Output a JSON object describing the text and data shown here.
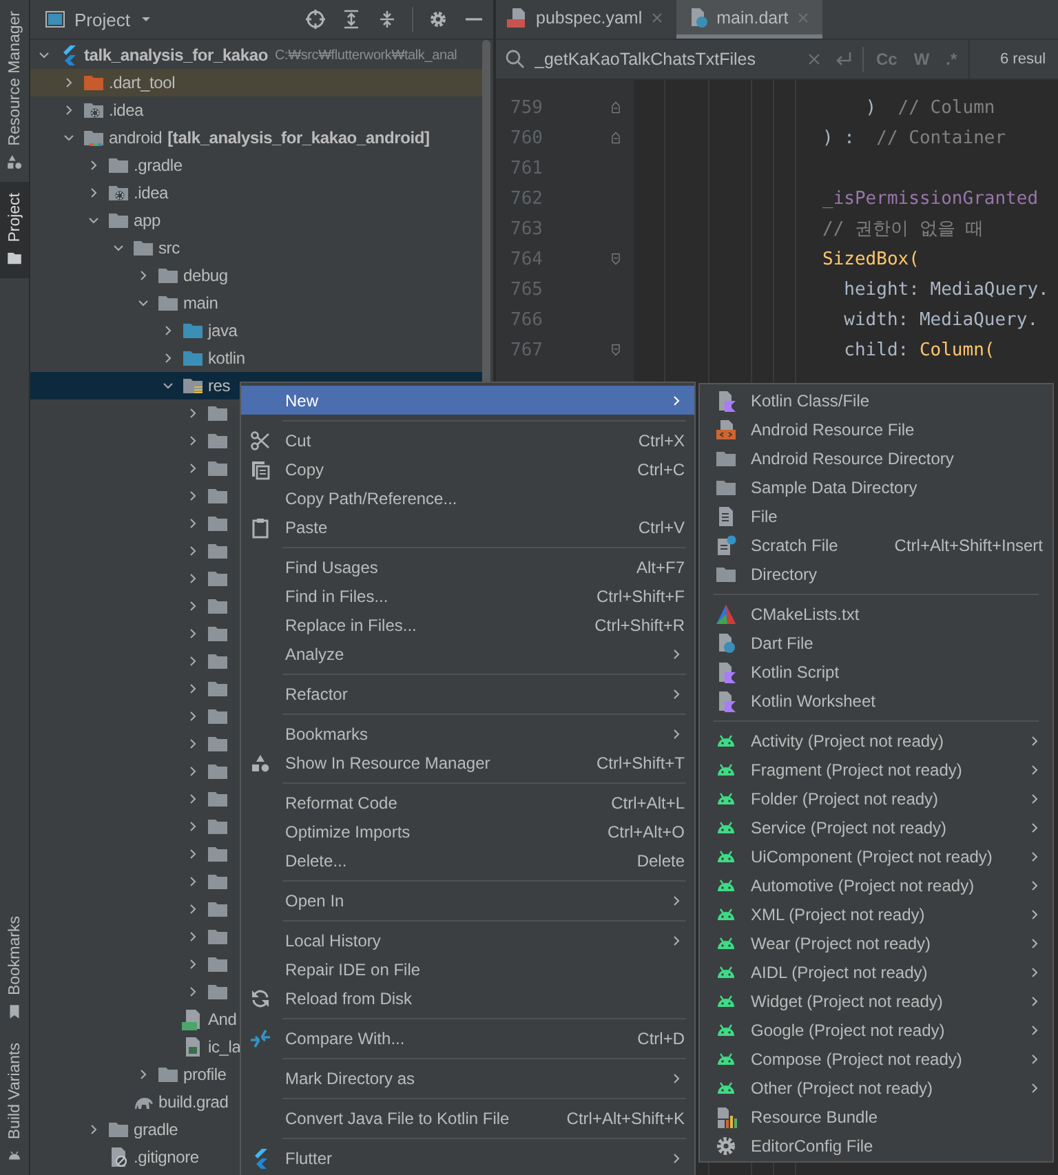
{
  "tool_strip": {
    "top": [
      {
        "label": "Resource Manager",
        "selected": false
      },
      {
        "label": "Project",
        "selected": true
      }
    ],
    "bottom": [
      {
        "label": "Bookmarks",
        "selected": false
      },
      {
        "label": "Build Variants",
        "selected": false
      }
    ]
  },
  "project_panel": {
    "view": "Project",
    "tree": [
      {
        "label": "talk_analysis_for_kakao",
        "path": "C:₩src₩flutterwork₩talk_anal",
        "kind": "project",
        "expanded": true,
        "selected": false,
        "children": [
          {
            "label": ".dart_tool",
            "kind": "excluded",
            "expanded": false,
            "selected": false
          },
          {
            "label": ".idea",
            "kind": "config",
            "expanded": false,
            "selected": false
          },
          {
            "label": "android",
            "module": "[talk_analysis_for_kakao_android]",
            "kind": "module",
            "expanded": true,
            "selected": false,
            "children": [
              {
                "label": ".gradle",
                "kind": "folder",
                "expanded": false,
                "selected": false
              },
              {
                "label": ".idea",
                "kind": "config",
                "expanded": false,
                "selected": false
              },
              {
                "label": "app",
                "kind": "folder",
                "expanded": true,
                "selected": false,
                "children": [
                  {
                    "label": "src",
                    "kind": "folder",
                    "expanded": true,
                    "selected": false,
                    "children": [
                      {
                        "label": "debug",
                        "kind": "folder",
                        "expanded": false,
                        "selected": false
                      },
                      {
                        "label": "main",
                        "kind": "folder",
                        "expanded": true,
                        "selected": false,
                        "children": [
                          {
                            "label": "java",
                            "kind": "source",
                            "expanded": false,
                            "selected": false
                          },
                          {
                            "label": "kotlin",
                            "kind": "source",
                            "expanded": false,
                            "selected": false
                          },
                          {
                            "label": "res",
                            "kind": "resources",
                            "expanded": true,
                            "selected": true,
                            "children": [
                              {
                                "kind": "folder",
                                "expanded": false,
                                "selected": false
                              },
                              {
                                "kind": "folder",
                                "expanded": false,
                                "selected": false
                              },
                              {
                                "kind": "folder",
                                "expanded": false,
                                "selected": false
                              },
                              {
                                "kind": "folder",
                                "expanded": false,
                                "selected": false
                              },
                              {
                                "kind": "folder",
                                "expanded": false,
                                "selected": false
                              },
                              {
                                "kind": "folder",
                                "expanded": false,
                                "selected": false
                              },
                              {
                                "kind": "folder",
                                "expanded": false,
                                "selected": false
                              },
                              {
                                "kind": "folder",
                                "expanded": false,
                                "selected": false
                              },
                              {
                                "kind": "folder",
                                "expanded": false,
                                "selected": false
                              },
                              {
                                "kind": "folder",
                                "expanded": false,
                                "selected": false
                              },
                              {
                                "kind": "folder",
                                "expanded": false,
                                "selected": false
                              },
                              {
                                "kind": "folder",
                                "expanded": false,
                                "selected": false
                              },
                              {
                                "kind": "folder",
                                "expanded": false,
                                "selected": false
                              },
                              {
                                "kind": "folder",
                                "expanded": false,
                                "selected": false
                              },
                              {
                                "kind": "folder",
                                "expanded": false,
                                "selected": false
                              },
                              {
                                "kind": "folder",
                                "expanded": false,
                                "selected": false
                              },
                              {
                                "kind": "folder",
                                "expanded": false,
                                "selected": false
                              },
                              {
                                "kind": "folder",
                                "expanded": false,
                                "selected": false
                              },
                              {
                                "kind": "folder",
                                "expanded": false,
                                "selected": false
                              },
                              {
                                "kind": "folder",
                                "expanded": false,
                                "selected": false
                              },
                              {
                                "kind": "folder",
                                "expanded": false,
                                "selected": false
                              },
                              {
                                "kind": "folder",
                                "expanded": false,
                                "selected": false
                              }
                            ]
                          },
                          {
                            "label": "And",
                            "kind": "manifest",
                            "selected": false
                          },
                          {
                            "label": "ic_la",
                            "kind": "image",
                            "selected": false
                          }
                        ]
                      },
                      {
                        "label": "profile",
                        "kind": "folder",
                        "expanded": false,
                        "selected": false
                      }
                    ]
                  },
                  {
                    "label": "build.grad",
                    "kind": "gradle",
                    "selected": false
                  }
                ]
              },
              {
                "label": "gradle",
                "kind": "folder",
                "expanded": false,
                "selected": false
              },
              {
                "label": ".gitignore",
                "kind": "ignore",
                "selected": false
              }
            ]
          }
        ]
      }
    ]
  },
  "editor": {
    "tabs": [
      {
        "label": "pubspec.yaml",
        "kind": "yaml",
        "selected": false
      },
      {
        "label": "main.dart",
        "kind": "dart",
        "selected": true
      }
    ],
    "search": {
      "value": "_getKaKaoTalkChatsTxtFiles",
      "options": [
        "Cc",
        "W",
        ".*"
      ],
      "results": "6 resul"
    },
    "lines": [
      {
        "number": "759",
        "tokens": [
          {
            "text": "    )",
            "kind": "plain"
          },
          {
            "text": "  // Column",
            "kind": "comment"
          }
        ]
      },
      {
        "number": "760",
        "tokens": [
          {
            "text": ") :  ",
            "kind": "plain"
          },
          {
            "text": "// Container",
            "kind": "comment"
          }
        ]
      },
      {
        "number": "761"
      },
      {
        "number": "762",
        "tokens": [
          {
            "text": "_isPermissionGranted",
            "kind": "field"
          }
        ]
      },
      {
        "number": "763",
        "tokens": [
          {
            "text": "// 권한이 없을 때",
            "kind": "comment"
          }
        ]
      },
      {
        "number": "764",
        "tokens": [
          {
            "text": "SizedBox(",
            "kind": "call"
          }
        ]
      },
      {
        "number": "765",
        "tokens": [
          {
            "text": "  height: MediaQuery.",
            "kind": "plain"
          }
        ]
      },
      {
        "number": "766",
        "tokens": [
          {
            "text": "  width: MediaQuery.",
            "kind": "plain"
          }
        ]
      },
      {
        "number": "767",
        "tokens": [
          {
            "text": "  child: ",
            "kind": "plain"
          },
          {
            "text": "Column(",
            "kind": "call"
          }
        ]
      }
    ]
  },
  "context_menu": {
    "items": [
      {
        "kind": "item",
        "label": "New",
        "has_submenu": true,
        "selected": true
      },
      {
        "kind": "separator"
      },
      {
        "kind": "item",
        "label": "Cut",
        "shortcut": "Ctrl+X",
        "has_submenu": false,
        "selected": false
      },
      {
        "kind": "item",
        "label": "Copy",
        "shortcut": "Ctrl+C",
        "has_submenu": false,
        "selected": false
      },
      {
        "kind": "item",
        "label": "Copy Path/Reference...",
        "has_submenu": false,
        "selected": false
      },
      {
        "kind": "item",
        "label": "Paste",
        "shortcut": "Ctrl+V",
        "has_submenu": false,
        "selected": false
      },
      {
        "kind": "separator"
      },
      {
        "kind": "item",
        "label": "Find Usages",
        "shortcut": "Alt+F7",
        "has_submenu": false,
        "selected": false
      },
      {
        "kind": "item",
        "label": "Find in Files...",
        "shortcut": "Ctrl+Shift+F",
        "has_submenu": false,
        "selected": false
      },
      {
        "kind": "item",
        "label": "Replace in Files...",
        "shortcut": "Ctrl+Shift+R",
        "has_submenu": false,
        "selected": false
      },
      {
        "kind": "item",
        "label": "Analyze",
        "has_submenu": true,
        "selected": false
      },
      {
        "kind": "separator"
      },
      {
        "kind": "item",
        "label": "Refactor",
        "has_submenu": true,
        "selected": false
      },
      {
        "kind": "separator"
      },
      {
        "kind": "item",
        "label": "Bookmarks",
        "has_submenu": true,
        "selected": false
      },
      {
        "kind": "item",
        "label": "Show In Resource Manager",
        "shortcut": "Ctrl+Shift+T",
        "has_submenu": false,
        "selected": false
      },
      {
        "kind": "separator"
      },
      {
        "kind": "item",
        "label": "Reformat Code",
        "shortcut": "Ctrl+Alt+L",
        "has_submenu": false,
        "selected": false
      },
      {
        "kind": "item",
        "label": "Optimize Imports",
        "shortcut": "Ctrl+Alt+O",
        "has_submenu": false,
        "selected": false
      },
      {
        "kind": "item",
        "label": "Delete...",
        "shortcut": "Delete",
        "has_submenu": false,
        "selected": false
      },
      {
        "kind": "separator"
      },
      {
        "kind": "item",
        "label": "Open In",
        "has_submenu": true,
        "selected": false
      },
      {
        "kind": "separator"
      },
      {
        "kind": "item",
        "label": "Local History",
        "has_submenu": true,
        "selected": false
      },
      {
        "kind": "item",
        "label": "Repair IDE on File",
        "has_submenu": false,
        "selected": false
      },
      {
        "kind": "item",
        "label": "Reload from Disk",
        "has_submenu": false,
        "selected": false
      },
      {
        "kind": "separator"
      },
      {
        "kind": "item",
        "label": "Compare With...",
        "shortcut": "Ctrl+D",
        "has_submenu": false,
        "selected": false
      },
      {
        "kind": "separator"
      },
      {
        "kind": "item",
        "label": "Mark Directory as",
        "has_submenu": true,
        "selected": false
      },
      {
        "kind": "separator"
      },
      {
        "kind": "item",
        "label": "Convert Java File to Kotlin File",
        "shortcut": "Ctrl+Alt+Shift+K",
        "has_submenu": false,
        "selected": false
      },
      {
        "kind": "separator"
      },
      {
        "kind": "item",
        "label": "Flutter",
        "has_submenu": true,
        "selected": false
      }
    ]
  },
  "submenu": {
    "items": [
      {
        "kind": "item",
        "label": "Kotlin Class/File",
        "has_submenu": false,
        "selected": false
      },
      {
        "kind": "item",
        "label": "Android Resource File",
        "has_submenu": false,
        "selected": false
      },
      {
        "kind": "item",
        "label": "Android Resource Directory",
        "has_submenu": false,
        "selected": false
      },
      {
        "kind": "item",
        "label": "Sample Data Directory",
        "has_submenu": false,
        "selected": false
      },
      {
        "kind": "item",
        "label": "File",
        "has_submenu": false,
        "selected": false
      },
      {
        "kind": "item",
        "label": "Scratch File",
        "shortcut": "Ctrl+Alt+Shift+Insert",
        "has_submenu": false,
        "selected": false
      },
      {
        "kind": "item",
        "label": "Directory",
        "has_submenu": false,
        "selected": false
      },
      {
        "kind": "separator"
      },
      {
        "kind": "item",
        "label": "CMakeLists.txt",
        "has_submenu": false,
        "selected": false
      },
      {
        "kind": "item",
        "label": "Dart File",
        "has_submenu": false,
        "selected": false
      },
      {
        "kind": "item",
        "label": "Kotlin Script",
        "has_submenu": false,
        "selected": false
      },
      {
        "kind": "item",
        "label": "Kotlin Worksheet",
        "has_submenu": false,
        "selected": false
      },
      {
        "kind": "separator"
      },
      {
        "kind": "item",
        "label": "Activity (Project not ready)",
        "has_submenu": true,
        "selected": false
      },
      {
        "kind": "item",
        "label": "Fragment (Project not ready)",
        "has_submenu": true,
        "selected": false
      },
      {
        "kind": "item",
        "label": "Folder (Project not ready)",
        "has_submenu": true,
        "selected": false
      },
      {
        "kind": "item",
        "label": "Service (Project not ready)",
        "has_submenu": true,
        "selected": false
      },
      {
        "kind": "item",
        "label": "UiComponent (Project not ready)",
        "has_submenu": true,
        "selected": false
      },
      {
        "kind": "item",
        "label": "Automotive (Project not ready)",
        "has_submenu": true,
        "selected": false
      },
      {
        "kind": "item",
        "label": "XML (Project not ready)",
        "has_submenu": true,
        "selected": false
      },
      {
        "kind": "item",
        "label": "Wear (Project not ready)",
        "has_submenu": true,
        "selected": false
      },
      {
        "kind": "item",
        "label": "AIDL (Project not ready)",
        "has_submenu": true,
        "selected": false
      },
      {
        "kind": "item",
        "label": "Widget (Project not ready)",
        "has_submenu": true,
        "selected": false
      },
      {
        "kind": "item",
        "label": "Google (Project not ready)",
        "has_submenu": true,
        "selected": false
      },
      {
        "kind": "item",
        "label": "Compose (Project not ready)",
        "has_submenu": true,
        "selected": false
      },
      {
        "kind": "item",
        "label": "Other (Project not ready)",
        "has_submenu": true,
        "selected": false
      },
      {
        "kind": "item",
        "label": "Resource Bundle",
        "has_submenu": false,
        "selected": false
      },
      {
        "kind": "item",
        "label": "EditorConfig File",
        "has_submenu": false,
        "selected": false
      }
    ]
  }
}
